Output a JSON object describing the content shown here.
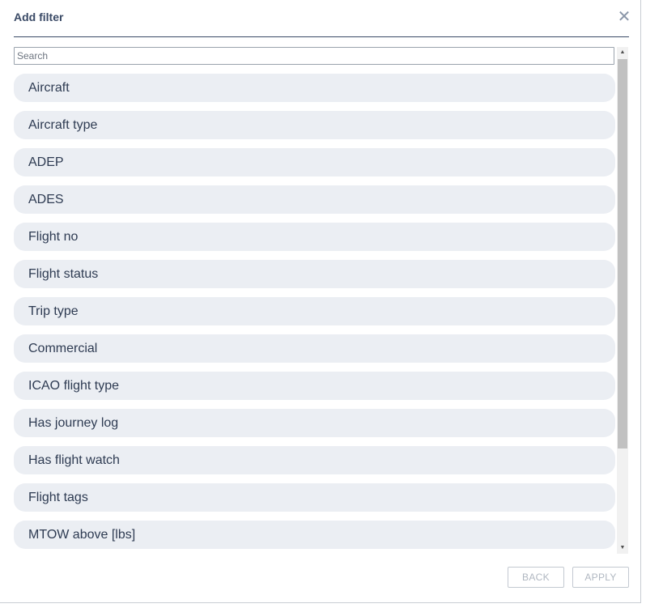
{
  "dialog": {
    "title": "Add filter",
    "close_icon": "close-icon",
    "close_glyph": "✕"
  },
  "search": {
    "value": "",
    "placeholder": "Search"
  },
  "filters": [
    {
      "label": "Aircraft"
    },
    {
      "label": "Aircraft type"
    },
    {
      "label": "ADEP"
    },
    {
      "label": "ADES"
    },
    {
      "label": "Flight no"
    },
    {
      "label": "Flight status"
    },
    {
      "label": "Trip type"
    },
    {
      "label": "Commercial"
    },
    {
      "label": "ICAO flight type"
    },
    {
      "label": "Has journey log"
    },
    {
      "label": "Has flight watch"
    },
    {
      "label": "Flight tags"
    },
    {
      "label": "MTOW above [lbs]"
    }
  ],
  "scrollbar": {
    "up_icon": "scroll-up-arrow-icon",
    "down_icon": "scroll-down-arrow-icon",
    "up_glyph": "▲",
    "down_glyph": "▼"
  },
  "footer": {
    "back_label": "BACK",
    "apply_label": "APPLY"
  },
  "colors": {
    "title": "#3a4a66",
    "item_background": "#ebeef3",
    "item_text": "#2e3b52",
    "disabled_button_text": "#b0b7c1"
  }
}
